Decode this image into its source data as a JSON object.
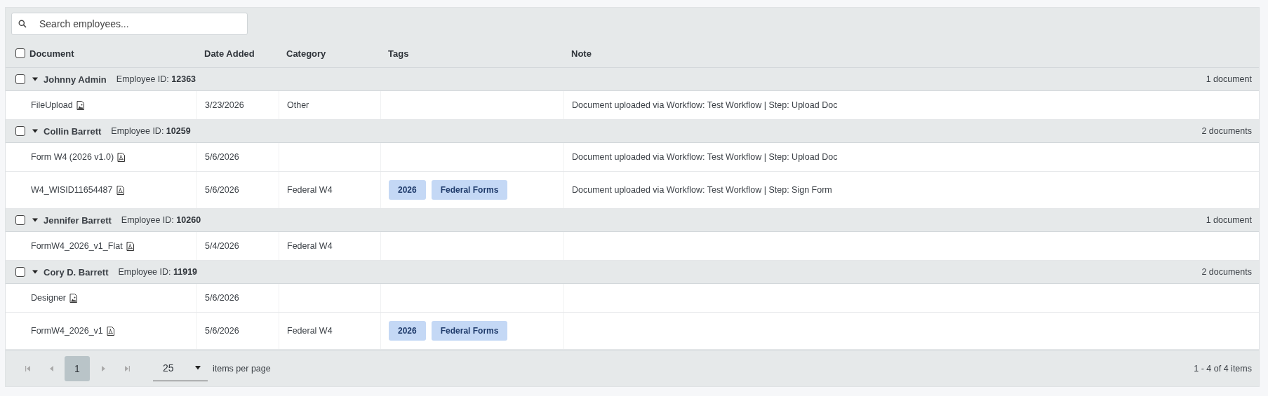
{
  "search": {
    "placeholder": "Search employees..."
  },
  "select_all": {
    "checked": false
  },
  "columns": [
    "Document",
    "Date Added",
    "Category",
    "Tags",
    "Note"
  ],
  "groups": [
    {
      "name": "Johnny Admin",
      "id_label": "Employee ID:",
      "id": "12363",
      "count": "1 document",
      "checked": false,
      "expanded": true,
      "documents": [
        {
          "name": "FileUpload",
          "kind": "image",
          "date": "3/23/2026",
          "category": "Other",
          "note": "Document uploaded via Workflow: Test Workflow | Step: Upload Doc"
        }
      ]
    },
    {
      "name": "Collin Barrett",
      "id_label": "Employee ID:",
      "id": "10259",
      "count": "2 documents",
      "checked": false,
      "expanded": true,
      "documents": [
        {
          "name": "Form W4 (2026 v1.0)",
          "kind": "pdf",
          "date": "5/6/2026",
          "note": "Document uploaded via Workflow: Test Workflow | Step: Upload Doc"
        },
        {
          "name": "W4_WISID11654487",
          "kind": "pdf",
          "date": "5/6/2026",
          "category": "Federal W4",
          "tags": [
            "2026",
            "Federal Forms"
          ],
          "note": "Document uploaded via Workflow: Test Workflow | Step: Sign Form"
        }
      ]
    },
    {
      "name": "Jennifer Barrett",
      "id_label": "Employee ID:",
      "id": "10260",
      "count": "1 document",
      "checked": false,
      "expanded": true,
      "documents": [
        {
          "name": "FormW4_2026_v1_Flat",
          "kind": "pdf",
          "date": "5/4/2026",
          "category": "Federal W4"
        }
      ]
    },
    {
      "name": "Cory D. Barrett",
      "id_label": "Employee ID:",
      "id": "11919",
      "count": "2 documents",
      "checked": false,
      "expanded": true,
      "documents": [
        {
          "name": "Designer",
          "kind": "image",
          "date": "5/6/2026"
        },
        {
          "name": "FormW4_2026_v1",
          "kind": "pdf",
          "date": "5/6/2026",
          "category": "Federal W4",
          "tags": [
            "2026",
            "Federal Forms"
          ]
        }
      ]
    }
  ],
  "pager": {
    "pages": [
      {
        "label": "1",
        "selected": true
      }
    ],
    "page_size": "25",
    "page_size_label": "items per page",
    "summary": "1 - 4 of 4 items"
  }
}
